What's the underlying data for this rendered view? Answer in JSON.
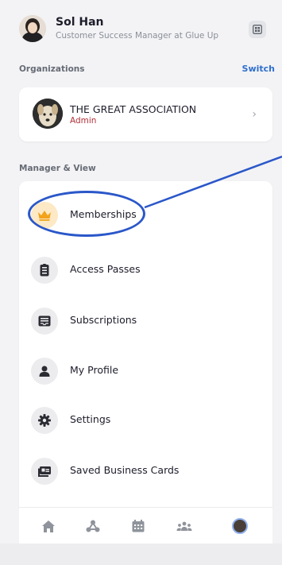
{
  "user": {
    "name": "Sol Han",
    "role": "Customer Success Manager at Glue Up"
  },
  "organizations": {
    "label": "Organizations",
    "switch_label": "Switch",
    "org_name": "THE GREAT ASSOCIATION",
    "org_role": "Admin"
  },
  "manager_view": {
    "label": "Manager & View",
    "items": [
      {
        "label": "Memberships",
        "icon": "crown-icon"
      },
      {
        "label": "Access Passes",
        "icon": "badge-icon"
      },
      {
        "label": "Subscriptions",
        "icon": "inbox-icon"
      },
      {
        "label": "My Profile",
        "icon": "person-icon"
      },
      {
        "label": "Settings",
        "icon": "gear-icon"
      },
      {
        "label": "Saved Business Cards",
        "icon": "business-card-icon"
      }
    ]
  },
  "tabbar": {
    "tabs": [
      "home-icon",
      "network-icon",
      "calendar-icon",
      "community-icon",
      "profile-avatar"
    ]
  },
  "colors": {
    "accent": "#2f6fcf",
    "admin": "#b0323a",
    "annotation": "#2a57c9",
    "crown": "#f2a21b"
  }
}
